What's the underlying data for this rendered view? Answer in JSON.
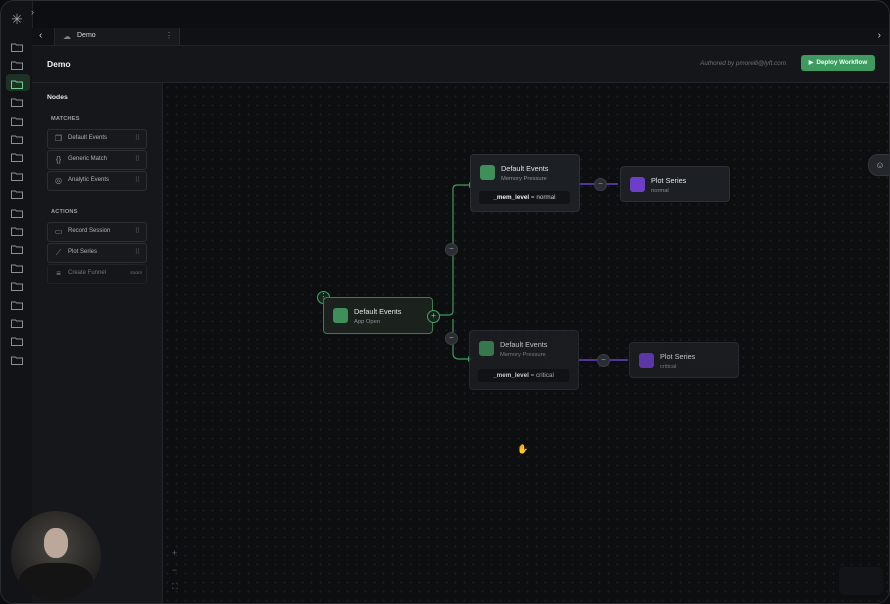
{
  "tabbar": {
    "back_icon": "chevron-left-icon",
    "tab_label": "Demo",
    "tab_icon": "workflow-icon",
    "tab_more_icon": "more-vertical-icon",
    "forward_icon": "chevron-right-icon"
  },
  "header": {
    "title": "Demo",
    "author": "Authored by pmorelli@lyft.com",
    "deploy_label": "Deploy Workflow"
  },
  "sidebar": {
    "title": "Nodes",
    "matches_label": "MATCHES",
    "matches": [
      {
        "label": "Default Events",
        "icon": "file-copy-icon"
      },
      {
        "label": "Generic Match",
        "icon": "braces-icon"
      },
      {
        "label": "Analytic Events",
        "icon": "target-icon"
      }
    ],
    "actions_label": "ACTIONS",
    "actions": [
      {
        "label": "Record Session",
        "icon": "video-icon"
      },
      {
        "label": "Plot Series",
        "icon": "line-chart-icon"
      },
      {
        "label": "Create Funnel",
        "icon": "funnel-icon",
        "badge": "soon!"
      }
    ]
  },
  "canvas": {
    "root": {
      "title": "Default Events",
      "subtitle": "App Open"
    },
    "top_match": {
      "title": "Default Events",
      "subtitle": "Memory Pressure",
      "field": "_mem_level",
      "op": "=",
      "value": "normal"
    },
    "bottom_match": {
      "title": "Default Events",
      "subtitle": "Memory Pressure",
      "field": "_mem_level",
      "op": "=",
      "value": "critical"
    },
    "top_action": {
      "title": "Plot Series",
      "subtitle": "normal"
    },
    "bottom_action": {
      "title": "Plot Series",
      "subtitle": "critical"
    },
    "colors": {
      "edge_green": "#3f9a5f",
      "edge_purple": "#6b3fc8"
    }
  },
  "zoom": {
    "in_icon": "plus-icon",
    "out_icon": "minus-icon",
    "fit_icon": "fit-screen-icon"
  },
  "chat_icon": "chat-icon"
}
